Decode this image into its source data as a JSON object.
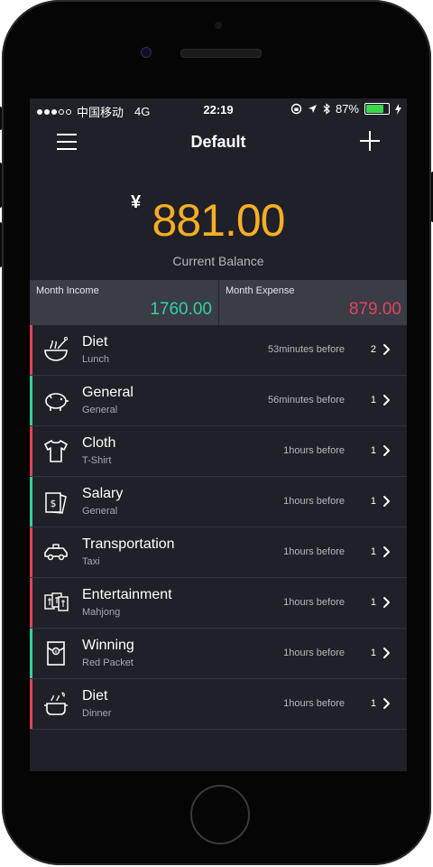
{
  "status_bar": {
    "carrier": "中国移动",
    "network": "4G",
    "time": "22:19",
    "battery": "87%",
    "battery_level": 0.87
  },
  "header": {
    "title": "Default"
  },
  "balance": {
    "currency": "¥",
    "amount": "881.00",
    "label": "Current Balance",
    "color": "#f7ad25"
  },
  "summary": {
    "income_label": "Month Income",
    "income_value": "1760.00",
    "income_color": "#34d1a0",
    "expense_label": "Month Expense",
    "expense_value": "879.00",
    "expense_color": "#e0445a"
  },
  "records": [
    {
      "category": "Diet",
      "sub": "Lunch",
      "time": "53minutes before",
      "count": "2",
      "type": "expense",
      "icon": "bowl-icon"
    },
    {
      "category": "General",
      "sub": "General",
      "time": "56minutes before",
      "count": "1",
      "type": "income",
      "icon": "piggy-bank-icon"
    },
    {
      "category": "Cloth",
      "sub": "T-Shirt",
      "time": "1hours before",
      "count": "1",
      "type": "expense",
      "icon": "tshirt-icon"
    },
    {
      "category": "Salary",
      "sub": "General",
      "time": "1hours before",
      "count": "1",
      "type": "income",
      "icon": "money-icon"
    },
    {
      "category": "Transportation",
      "sub": "Taxi",
      "time": "1hours before",
      "count": "1",
      "type": "expense",
      "icon": "taxi-icon"
    },
    {
      "category": "Entertainment",
      "sub": "Mahjong",
      "time": "1hours before",
      "count": "1",
      "type": "expense",
      "icon": "mahjong-icon"
    },
    {
      "category": "Winning",
      "sub": "Red Packet",
      "time": "1hours before",
      "count": "1",
      "type": "income",
      "icon": "red-packet-icon"
    },
    {
      "category": "Diet",
      "sub": "Dinner",
      "time": "1hours before",
      "count": "1",
      "type": "expense",
      "icon": "pot-icon"
    }
  ],
  "colors": {
    "expense": "#e0445a",
    "income": "#34d1a0"
  }
}
